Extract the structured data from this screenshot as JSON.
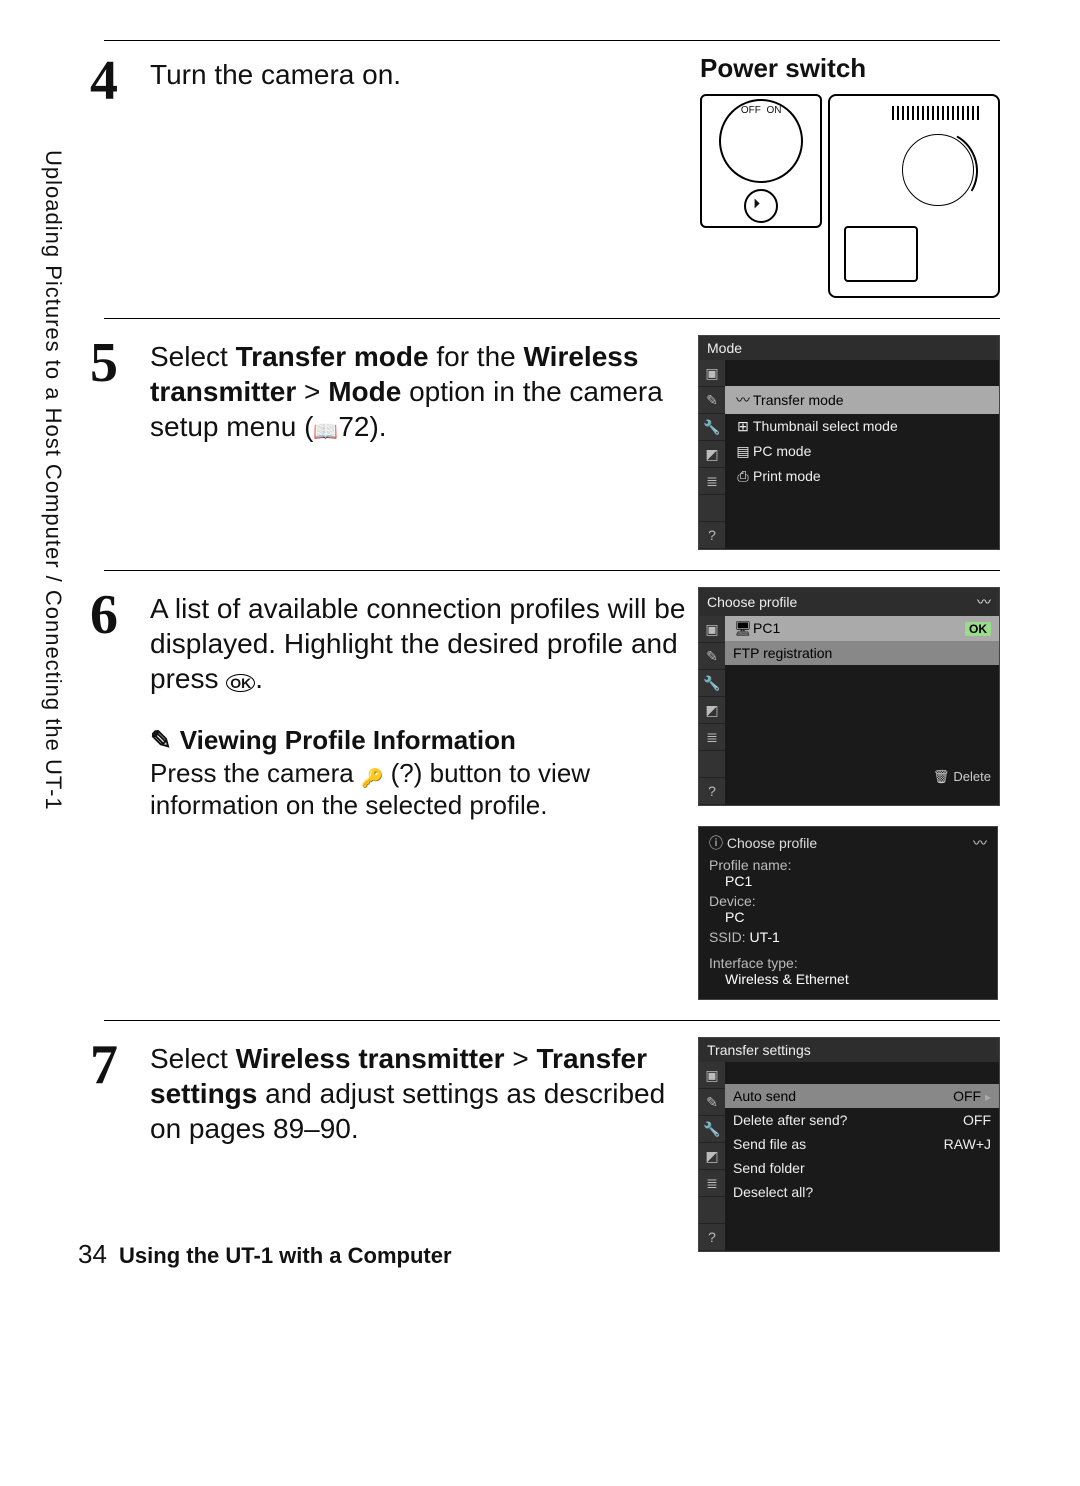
{
  "breadcrumb": "Uploading Pictures to a Host Computer / Connecting the UT-1",
  "steps": {
    "s4": {
      "num": "4",
      "text": "Turn the camera on.",
      "caption": "Power switch"
    },
    "s5": {
      "num": "5",
      "pre": "Select ",
      "b1": "Transfer mode",
      "mid1": " for the ",
      "b2": "Wireless transmitter",
      "gt": " > ",
      "b3": "Mode",
      "mid2": " option in the camera setup menu (",
      "pageref": "72",
      "post": ").",
      "menu": {
        "title": "Mode",
        "items": [
          "Transfer mode",
          "Thumbnail select mode",
          "PC mode",
          "Print mode"
        ]
      }
    },
    "s6": {
      "num": "6",
      "t1": "A list of available connection profiles will be displayed.  Highlight the desired profile and press ",
      "t2": ".",
      "menu": {
        "title": "Choose profile",
        "profile": "PC1",
        "row2": "FTP registration",
        "delete": "Delete"
      },
      "note_title": "Viewing Profile Information",
      "note_t1": "Press the camera ",
      "note_t2": " (?) button to view information on the selected profile.",
      "info": {
        "title": "Choose profile",
        "pn_lbl": "Profile name:",
        "pn_val": "PC1",
        "dv_lbl": "Device:",
        "dv_val": "PC",
        "ss_lbl": "SSID:",
        "ss_val": "UT-1",
        "it_lbl": "Interface type:",
        "it_val": "Wireless & Ethernet"
      }
    },
    "s7": {
      "num": "7",
      "pre": "Select ",
      "b1": "Wireless transmitter",
      "gt": " > ",
      "b2": "Transfer settings",
      "post": " and adjust settings as described on pages 89–90.",
      "menu": {
        "title": "Transfer settings",
        "rows": [
          {
            "l": "Auto send",
            "v": "OFF",
            "arr": true
          },
          {
            "l": "Delete after send?",
            "v": "OFF"
          },
          {
            "l": "Send file as",
            "v": "RAW+J"
          },
          {
            "l": "Send folder",
            "v": ""
          },
          {
            "l": "Deselect all?",
            "v": ""
          }
        ]
      }
    }
  },
  "footer": {
    "page": "34",
    "chapter": "Using the UT-1 with a Computer"
  }
}
